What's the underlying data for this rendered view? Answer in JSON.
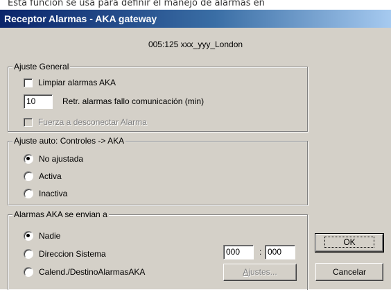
{
  "caption": "Esta función se usa para definir el manejo de alarmas en",
  "window": {
    "title": "Receptor Alarmas - AKA gateway"
  },
  "header": {
    "device": "005:125  xxx_yyy_London"
  },
  "ajuste_general": {
    "legend": "Ajuste General",
    "limpiar_label": "Limpiar alarmas AKA",
    "retr_value": "10",
    "retr_label": "Retr. alarmas fallo comunicación (min)",
    "fuerza_label": "Fuerza a desconectar Alarma"
  },
  "ajuste_auto": {
    "legend": "Ajuste auto: Controles -> AKA",
    "options": [
      "No ajustada",
      "Activa",
      "Inactiva"
    ],
    "selected": "No ajustada"
  },
  "alarmas": {
    "legend": "Alarmas AKA se envian a",
    "options": [
      "Nadie",
      "Direccion Sistema",
      "Calend./DestinoAlarmasAKA"
    ],
    "selected": "Nadie",
    "addr_a": "000",
    "addr_sep": ":",
    "addr_b": "000",
    "ajustes_label_underlined": "A",
    "ajustes_label_rest": "justes..."
  },
  "buttons": {
    "ok": "OK",
    "cancel": "Cancelar"
  }
}
